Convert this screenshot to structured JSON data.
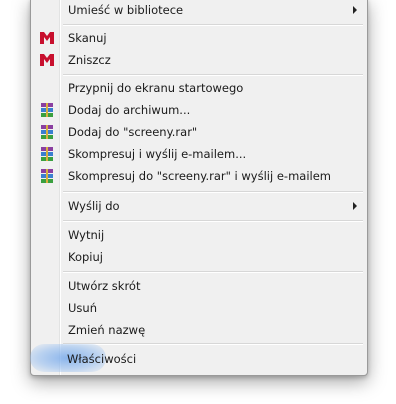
{
  "menu": {
    "items": [
      {
        "label": "Umieść w bibliotece",
        "submenu": true,
        "icon": null
      },
      {
        "label": "Skanuj",
        "icon": "mcafee-icon"
      },
      {
        "label": "Zniszcz",
        "icon": "mcafee-icon"
      },
      {
        "label": "Przypnij do ekranu startowego",
        "icon": null
      },
      {
        "label": "Dodaj do archiwum...",
        "icon": "winrar-icon"
      },
      {
        "label": "Dodaj do \"screeny.rar\"",
        "icon": "winrar-icon"
      },
      {
        "label": "Skompresuj i wyślij e-mailem...",
        "icon": "winrar-icon"
      },
      {
        "label": "Skompresuj do \"screeny.rar\" i wyślij e-mailem",
        "icon": "winrar-icon"
      },
      {
        "label": "Wyślij do",
        "submenu": true,
        "icon": null
      },
      {
        "label": "Wytnij",
        "icon": null
      },
      {
        "label": "Kopiuj",
        "icon": null
      },
      {
        "label": "Utwórz skrót",
        "icon": null
      },
      {
        "label": "Usuń",
        "icon": null
      },
      {
        "label": "Zmień nazwę",
        "icon": null
      },
      {
        "label": "Właściwości",
        "icon": null,
        "highlighted": true
      }
    ]
  },
  "colors": {
    "menu_bg": "#f0f0f0",
    "mcafee_red": "#c8102e",
    "highlight_blue": "#78aaeb"
  }
}
